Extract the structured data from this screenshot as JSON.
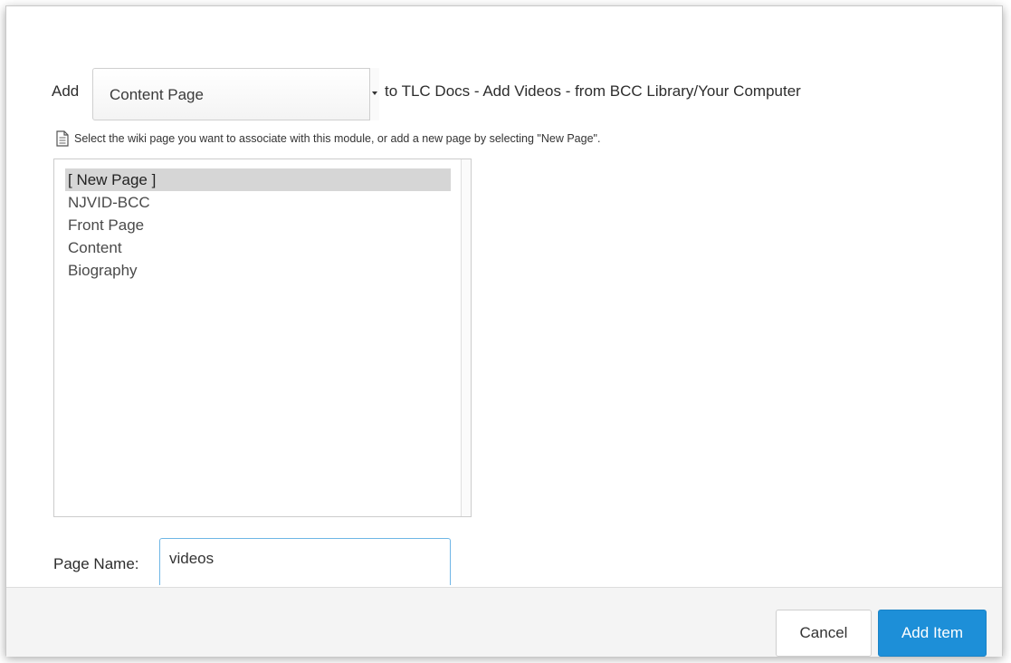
{
  "header": {
    "add_label": "Add",
    "item_type_selected": "Content Page",
    "target_text": "to TLC Docs - Add Videos - from BCC Library/Your Computer"
  },
  "hint": {
    "icon": "document-icon",
    "text": "Select the wiki page you want to associate with this module, or add a new page by selecting \"New Page\"."
  },
  "page_list": {
    "items": [
      "[ New Page ]",
      "NJVID-BCC",
      "Front Page",
      "Content",
      "Biography"
    ],
    "selected_index": 0
  },
  "page_name": {
    "label": "Page Name:",
    "value": "videos"
  },
  "footer": {
    "cancel_label": "Cancel",
    "add_item_label": "Add Item"
  },
  "colors": {
    "primary_button": "#1d8fd8",
    "input_focus_border": "#6fb6e6",
    "selected_row": "#d6d6d6"
  }
}
